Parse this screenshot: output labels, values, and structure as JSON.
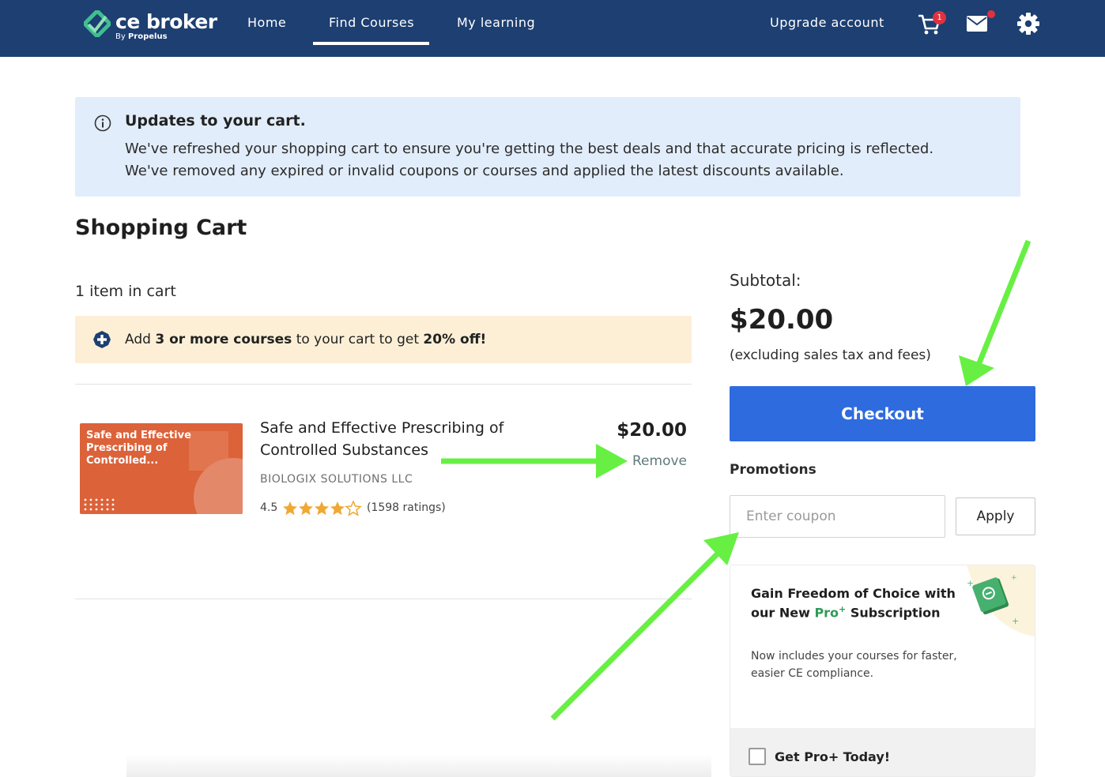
{
  "app": {
    "logo_text": "ce broker",
    "logo_sub_prefix": "By ",
    "logo_sub_brand": "Propelus"
  },
  "nav": {
    "items": [
      {
        "label": "Home"
      },
      {
        "label": "Find Courses"
      },
      {
        "label": "My learning"
      }
    ],
    "active_index": 1,
    "upgrade_label": "Upgrade account",
    "cart_count": "1",
    "icons": [
      "cart-icon",
      "mail-icon",
      "gear-icon"
    ]
  },
  "info_banner": {
    "icon": "info-icon",
    "title": "Updates to your cart.",
    "line1": "We've refreshed your shopping cart to ensure you're getting the best deals and that accurate pricing is reflected.",
    "line2": "We've removed any expired or invalid coupons or courses and applied the latest discounts available."
  },
  "cart": {
    "title": "Shopping Cart",
    "item_count": "1 item in cart",
    "promo": {
      "icon": "plus-circle-icon",
      "prefix": "Add ",
      "highlight1": "3 or more courses",
      "middle": " to your cart to get ",
      "highlight2": "20% off!"
    },
    "items": [
      {
        "thumb_text": "Safe and Effective Prescribing of Controlled...",
        "title": "Safe and Effective Prescribing of Controlled Substances",
        "provider": "BIOLOGIX SOLUTIONS LLC",
        "rating": "4.5",
        "rating_value": 4.5,
        "rating_max": 5,
        "rating_count": "(1598 ratings)",
        "price": "$20.00",
        "remove_label": "Remove"
      }
    ]
  },
  "summary": {
    "subtotal_label": "Subtotal:",
    "subtotal_value": "$20.00",
    "note": "(excluding sales tax and fees)",
    "checkout_label": "Checkout",
    "promotions_label": "Promotions",
    "coupon_placeholder": "Enter coupon",
    "coupon_value": "",
    "apply_label": "Apply"
  },
  "pro_card": {
    "title_part1": "Gain Freedom of Choice with our New ",
    "title_pro": "Pro",
    "title_sup": "+",
    "title_part2": " Subscription",
    "description": "Now includes your courses for faster, easier CE compliance.",
    "checkbox_label": "Get Pro+ Today!",
    "checked": false
  },
  "colors": {
    "nav_bg": "#1d3f72",
    "checkout_bg": "#2e6bdf",
    "info_bg": "#e2edfb",
    "promo_bg": "#fcefd6",
    "annotation_arrow": "#67f043",
    "thumb_bg": "#dc6239",
    "pro_green": "#2f9b57"
  }
}
